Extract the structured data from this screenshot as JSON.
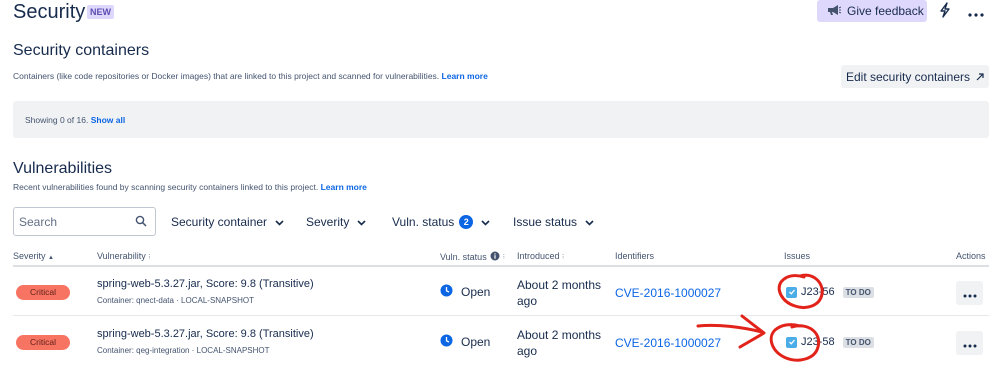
{
  "header": {
    "title": "Security",
    "badge": "NEW",
    "feedback_label": "Give feedback",
    "icons": [
      "megaphone-icon",
      "lightning-icon",
      "more-icon"
    ]
  },
  "containers": {
    "heading": "Security containers",
    "description": "Containers (like code repositories or Docker images) that are linked to this project and scanned for vulnerabilities.",
    "learn_more": "Learn more",
    "edit_label": "Edit security containers",
    "showing_text": "Showing 0 of 16.",
    "show_all": "Show all"
  },
  "vulnerabilities": {
    "heading": "Vulnerabilities",
    "description": "Recent vulnerabilities found by scanning security containers linked to this project.",
    "learn_more": "Learn more",
    "search_placeholder": "Search",
    "filters": {
      "security_container": "Security container",
      "severity": "Severity",
      "vuln_status": "Vuln. status",
      "vuln_status_count": "2",
      "issue_status": "Issue status"
    },
    "columns": {
      "severity": "Severity",
      "vulnerability": "Vulnerability",
      "vuln_status": "Vuln. status",
      "introduced": "Introduced",
      "identifiers": "Identifiers",
      "issues": "Issues",
      "actions": "Actions"
    },
    "rows": [
      {
        "severity": "Critical",
        "name": "spring-web-5.3.27.jar, Score: 9.8 (Transitive)",
        "container": "Container: qnect-data · LOCAL-SNAPSHOT",
        "status": "Open",
        "introduced": "About 2 months ago",
        "identifier": "CVE-2016-1000027",
        "issue_key": "J23-56",
        "issue_status": "TO DO"
      },
      {
        "severity": "Critical",
        "name": "spring-web-5.3.27.jar, Score: 9.8 (Transitive)",
        "container": "Container: qeg-integration · LOCAL-SNAPSHOT",
        "status": "Open",
        "introduced": "About 2 months ago",
        "identifier": "CVE-2016-1000027",
        "issue_key": "J23-58",
        "issue_status": "TO DO"
      }
    ]
  },
  "colors": {
    "accent": "#0c66e4",
    "critical": "#f87462",
    "feedback_bg": "#dfd8fd",
    "annotation": "#e2231a"
  }
}
